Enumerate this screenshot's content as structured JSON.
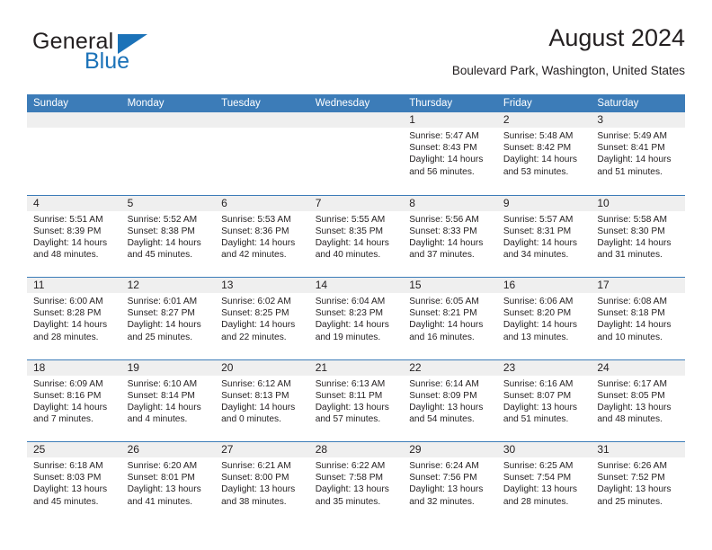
{
  "logo": {
    "word_one": "General",
    "word_two": "Blue",
    "accent_color": "#1b72b8",
    "text_color": "#231f20"
  },
  "header": {
    "title": "August 2024",
    "subtitle": "Boulevard Park, Washington, United States"
  },
  "theme": {
    "header_blue": "#3c7cb8",
    "daynum_band": "#efefef",
    "text": "#231f20"
  },
  "calendar": {
    "weekday_headers": [
      "Sunday",
      "Monday",
      "Tuesday",
      "Wednesday",
      "Thursday",
      "Friday",
      "Saturday"
    ],
    "weeks": [
      [
        {
          "day": "",
          "empty": true
        },
        {
          "day": "",
          "empty": true
        },
        {
          "day": "",
          "empty": true
        },
        {
          "day": "",
          "empty": true
        },
        {
          "day": "1",
          "sunrise": "Sunrise: 5:47 AM",
          "sunset": "Sunset: 8:43 PM",
          "daylight": "Daylight: 14 hours and 56 minutes."
        },
        {
          "day": "2",
          "sunrise": "Sunrise: 5:48 AM",
          "sunset": "Sunset: 8:42 PM",
          "daylight": "Daylight: 14 hours and 53 minutes."
        },
        {
          "day": "3",
          "sunrise": "Sunrise: 5:49 AM",
          "sunset": "Sunset: 8:41 PM",
          "daylight": "Daylight: 14 hours and 51 minutes."
        }
      ],
      [
        {
          "day": "4",
          "sunrise": "Sunrise: 5:51 AM",
          "sunset": "Sunset: 8:39 PM",
          "daylight": "Daylight: 14 hours and 48 minutes."
        },
        {
          "day": "5",
          "sunrise": "Sunrise: 5:52 AM",
          "sunset": "Sunset: 8:38 PM",
          "daylight": "Daylight: 14 hours and 45 minutes."
        },
        {
          "day": "6",
          "sunrise": "Sunrise: 5:53 AM",
          "sunset": "Sunset: 8:36 PM",
          "daylight": "Daylight: 14 hours and 42 minutes."
        },
        {
          "day": "7",
          "sunrise": "Sunrise: 5:55 AM",
          "sunset": "Sunset: 8:35 PM",
          "daylight": "Daylight: 14 hours and 40 minutes."
        },
        {
          "day": "8",
          "sunrise": "Sunrise: 5:56 AM",
          "sunset": "Sunset: 8:33 PM",
          "daylight": "Daylight: 14 hours and 37 minutes."
        },
        {
          "day": "9",
          "sunrise": "Sunrise: 5:57 AM",
          "sunset": "Sunset: 8:31 PM",
          "daylight": "Daylight: 14 hours and 34 minutes."
        },
        {
          "day": "10",
          "sunrise": "Sunrise: 5:58 AM",
          "sunset": "Sunset: 8:30 PM",
          "daylight": "Daylight: 14 hours and 31 minutes."
        }
      ],
      [
        {
          "day": "11",
          "sunrise": "Sunrise: 6:00 AM",
          "sunset": "Sunset: 8:28 PM",
          "daylight": "Daylight: 14 hours and 28 minutes."
        },
        {
          "day": "12",
          "sunrise": "Sunrise: 6:01 AM",
          "sunset": "Sunset: 8:27 PM",
          "daylight": "Daylight: 14 hours and 25 minutes."
        },
        {
          "day": "13",
          "sunrise": "Sunrise: 6:02 AM",
          "sunset": "Sunset: 8:25 PM",
          "daylight": "Daylight: 14 hours and 22 minutes."
        },
        {
          "day": "14",
          "sunrise": "Sunrise: 6:04 AM",
          "sunset": "Sunset: 8:23 PM",
          "daylight": "Daylight: 14 hours and 19 minutes."
        },
        {
          "day": "15",
          "sunrise": "Sunrise: 6:05 AM",
          "sunset": "Sunset: 8:21 PM",
          "daylight": "Daylight: 14 hours and 16 minutes."
        },
        {
          "day": "16",
          "sunrise": "Sunrise: 6:06 AM",
          "sunset": "Sunset: 8:20 PM",
          "daylight": "Daylight: 14 hours and 13 minutes."
        },
        {
          "day": "17",
          "sunrise": "Sunrise: 6:08 AM",
          "sunset": "Sunset: 8:18 PM",
          "daylight": "Daylight: 14 hours and 10 minutes."
        }
      ],
      [
        {
          "day": "18",
          "sunrise": "Sunrise: 6:09 AM",
          "sunset": "Sunset: 8:16 PM",
          "daylight": "Daylight: 14 hours and 7 minutes."
        },
        {
          "day": "19",
          "sunrise": "Sunrise: 6:10 AM",
          "sunset": "Sunset: 8:14 PM",
          "daylight": "Daylight: 14 hours and 4 minutes."
        },
        {
          "day": "20",
          "sunrise": "Sunrise: 6:12 AM",
          "sunset": "Sunset: 8:13 PM",
          "daylight": "Daylight: 14 hours and 0 minutes."
        },
        {
          "day": "21",
          "sunrise": "Sunrise: 6:13 AM",
          "sunset": "Sunset: 8:11 PM",
          "daylight": "Daylight: 13 hours and 57 minutes."
        },
        {
          "day": "22",
          "sunrise": "Sunrise: 6:14 AM",
          "sunset": "Sunset: 8:09 PM",
          "daylight": "Daylight: 13 hours and 54 minutes."
        },
        {
          "day": "23",
          "sunrise": "Sunrise: 6:16 AM",
          "sunset": "Sunset: 8:07 PM",
          "daylight": "Daylight: 13 hours and 51 minutes."
        },
        {
          "day": "24",
          "sunrise": "Sunrise: 6:17 AM",
          "sunset": "Sunset: 8:05 PM",
          "daylight": "Daylight: 13 hours and 48 minutes."
        }
      ],
      [
        {
          "day": "25",
          "sunrise": "Sunrise: 6:18 AM",
          "sunset": "Sunset: 8:03 PM",
          "daylight": "Daylight: 13 hours and 45 minutes."
        },
        {
          "day": "26",
          "sunrise": "Sunrise: 6:20 AM",
          "sunset": "Sunset: 8:01 PM",
          "daylight": "Daylight: 13 hours and 41 minutes."
        },
        {
          "day": "27",
          "sunrise": "Sunrise: 6:21 AM",
          "sunset": "Sunset: 8:00 PM",
          "daylight": "Daylight: 13 hours and 38 minutes."
        },
        {
          "day": "28",
          "sunrise": "Sunrise: 6:22 AM",
          "sunset": "Sunset: 7:58 PM",
          "daylight": "Daylight: 13 hours and 35 minutes."
        },
        {
          "day": "29",
          "sunrise": "Sunrise: 6:24 AM",
          "sunset": "Sunset: 7:56 PM",
          "daylight": "Daylight: 13 hours and 32 minutes."
        },
        {
          "day": "30",
          "sunrise": "Sunrise: 6:25 AM",
          "sunset": "Sunset: 7:54 PM",
          "daylight": "Daylight: 13 hours and 28 minutes."
        },
        {
          "day": "31",
          "sunrise": "Sunrise: 6:26 AM",
          "sunset": "Sunset: 7:52 PM",
          "daylight": "Daylight: 13 hours and 25 minutes."
        }
      ]
    ]
  }
}
